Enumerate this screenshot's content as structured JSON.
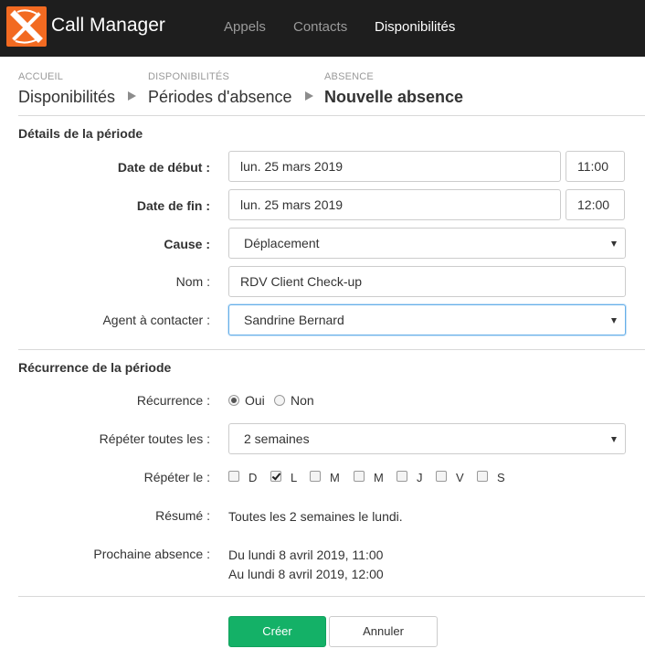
{
  "app": {
    "title": "Call Manager",
    "logo_icon": "call-manager-x-logo",
    "brand_color": "#f26a21"
  },
  "nav": {
    "items": [
      {
        "label": "Appels",
        "active": false
      },
      {
        "label": "Contacts",
        "active": false
      },
      {
        "label": "Disponibilités",
        "active": true
      }
    ]
  },
  "breadcrumb": {
    "items": [
      {
        "small": "ACCUEIL",
        "label": "Disponibilités"
      },
      {
        "small": "DISPONIBILITÉS",
        "label": "Périodes d'absence"
      },
      {
        "small": "ABSENCE",
        "label": "Nouvelle absence"
      }
    ]
  },
  "details": {
    "title": "Détails de la période",
    "start": {
      "label": "Date de début :",
      "date": "lun. 25 mars 2019",
      "time": "11:00"
    },
    "end": {
      "label": "Date de fin :",
      "date": "lun. 25 mars 2019",
      "time": "12:00"
    },
    "cause": {
      "label": "Cause :",
      "value": "Déplacement"
    },
    "name": {
      "label": "Nom :",
      "value": "RDV Client Check-up"
    },
    "agent": {
      "label": "Agent à contacter :",
      "value": "Sandrine Bernard"
    }
  },
  "recurrence": {
    "title": "Récurrence de la période",
    "recurrence_label": "Récurrence :",
    "options": [
      {
        "label": "Oui",
        "checked": true
      },
      {
        "label": "Non",
        "checked": false
      }
    ],
    "repeat_every_label": "Répéter toutes les :",
    "repeat_every_value": "2 semaines",
    "repeat_on_label": "Répéter le :",
    "days": [
      {
        "label": "D",
        "checked": false
      },
      {
        "label": "L",
        "checked": true
      },
      {
        "label": "M",
        "checked": false
      },
      {
        "label": "M",
        "checked": false
      },
      {
        "label": "J",
        "checked": false
      },
      {
        "label": "V",
        "checked": false
      },
      {
        "label": "S",
        "checked": false
      }
    ],
    "summary_label": "Résumé :",
    "summary_value": "Toutes les 2 semaines le lundi.",
    "next_label": "Prochaine absence :",
    "next_from": "Du lundi 8 avril 2019, 11:00",
    "next_to": "Au lundi 8 avril 2019, 12:00"
  },
  "actions": {
    "create_label": "Créer",
    "cancel_label": "Annuler",
    "create_color": "#14b167"
  }
}
